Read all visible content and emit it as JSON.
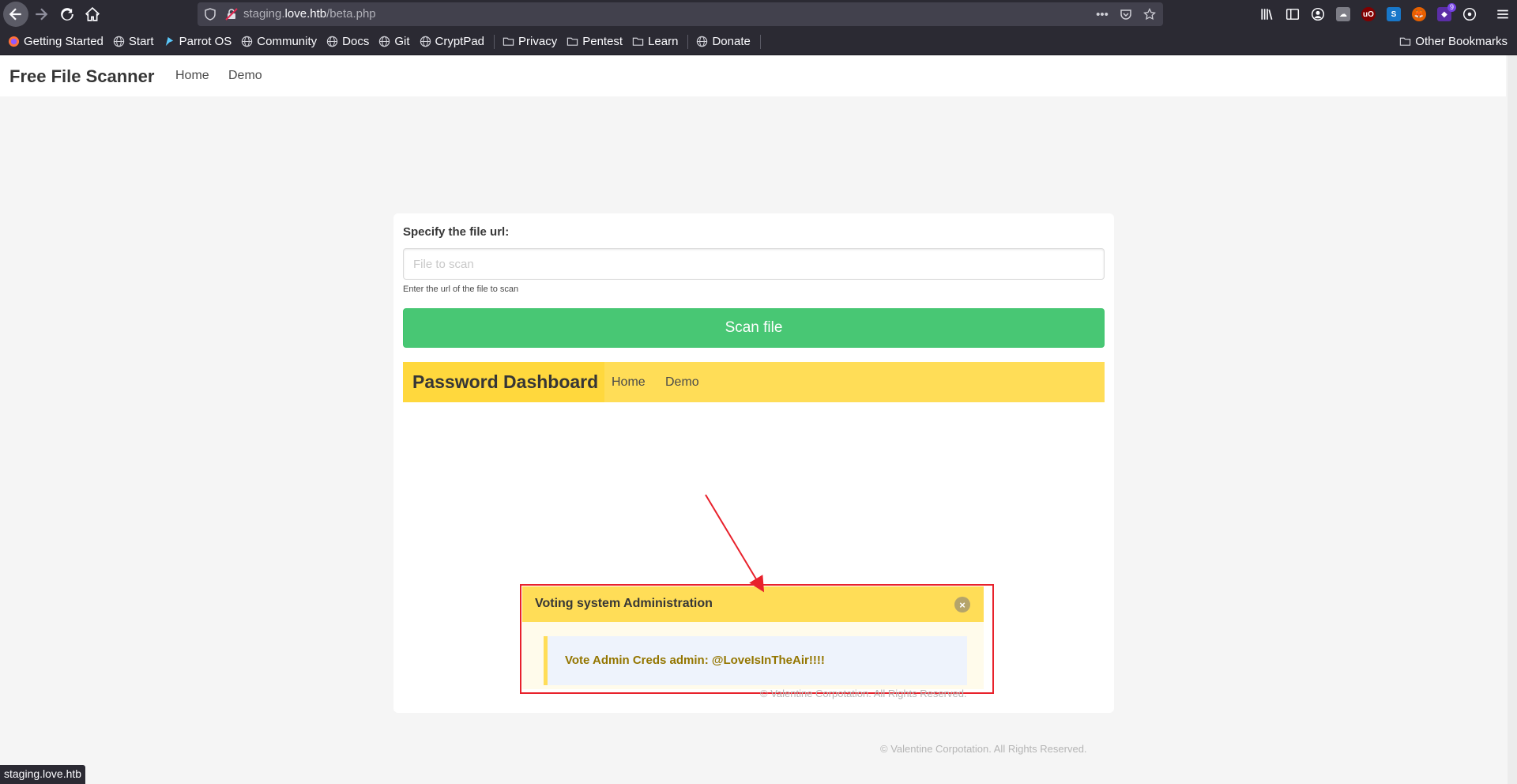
{
  "browser": {
    "url_subdomain": "staging.",
    "url_domain": "love.htb",
    "url_path": "/beta.php",
    "status_text": "staging.love.htb",
    "extension_badge": "9",
    "bookmarks": [
      {
        "label": "Getting Started",
        "icon": "firefox-icon"
      },
      {
        "label": "Start",
        "icon": "globe-icon"
      },
      {
        "label": "Parrot OS",
        "icon": "parrot-icon"
      },
      {
        "label": "Community",
        "icon": "globe-icon"
      },
      {
        "label": "Docs",
        "icon": "globe-icon"
      },
      {
        "label": "Git",
        "icon": "globe-icon"
      },
      {
        "label": "CryptPad",
        "icon": "globe-icon"
      },
      {
        "label": "Privacy",
        "icon": "folder-icon"
      },
      {
        "label": "Pentest",
        "icon": "folder-icon"
      },
      {
        "label": "Learn",
        "icon": "folder-icon"
      },
      {
        "label": "Donate",
        "icon": "globe-icon"
      }
    ],
    "other_bookmarks": "Other Bookmarks"
  },
  "site": {
    "brand": "Free File Scanner",
    "nav_home": "Home",
    "nav_demo": "Demo"
  },
  "form": {
    "label": "Specify the file url:",
    "placeholder": "File to scan",
    "value": "",
    "help": "Enter the url of the file to scan",
    "button": "Scan file"
  },
  "result": {
    "brand": "Password Dashboard",
    "nav_home": "Home",
    "nav_demo": "Demo",
    "notification_title": "Voting system Administration",
    "notification_message": "Vote Admin Creds admin: @LoveIsInTheAir!!!!",
    "footer": "© Valentine Corpotation. All Rights Reserved."
  },
  "footer": "© Valentine Corpotation. All Rights Reserved.",
  "colors": {
    "accent_green": "#48c774",
    "accent_yellow": "#ffdd57",
    "annotation_red": "#e8212b"
  }
}
